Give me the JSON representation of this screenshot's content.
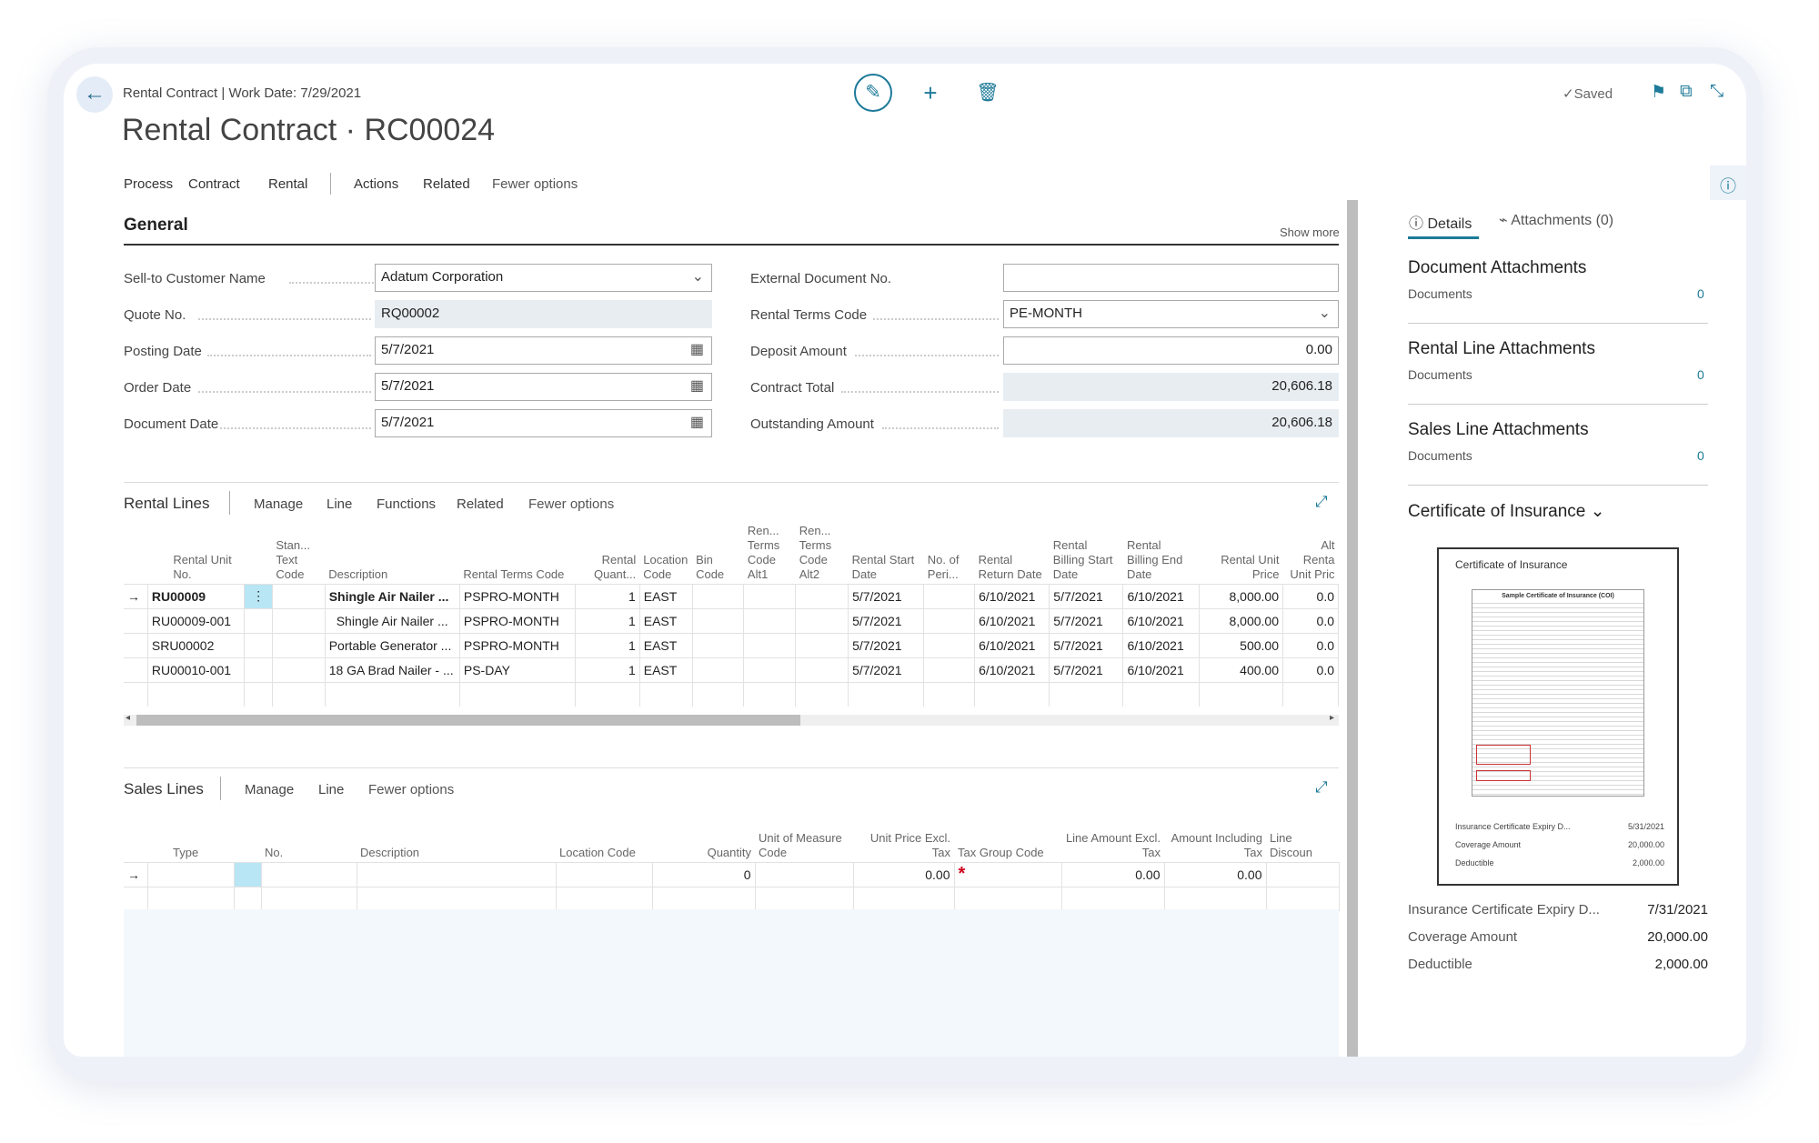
{
  "header": {
    "breadcrumb": "Rental Contract | Work Date: 7/29/2021",
    "title": "Rental Contract · RC00024",
    "saved": "Saved"
  },
  "menu": [
    "Process",
    "Contract",
    "Rental",
    "Actions",
    "Related",
    "Fewer options"
  ],
  "general": {
    "title": "General",
    "show_more": "Show more",
    "left": [
      {
        "label": "Sell-to Customer Name",
        "value": "Adatum Corporation"
      },
      {
        "label": "Quote No.",
        "value": "RQ00002"
      },
      {
        "label": "Posting Date",
        "value": "5/7/2021"
      },
      {
        "label": "Order Date",
        "value": "5/7/2021"
      },
      {
        "label": "Document Date",
        "value": "5/7/2021"
      }
    ],
    "right": [
      {
        "label": "External Document No.",
        "value": ""
      },
      {
        "label": "Rental Terms Code",
        "value": "PE-MONTH"
      },
      {
        "label": "Deposit Amount",
        "value": "0.00"
      },
      {
        "label": "Contract Total",
        "value": "20,606.18"
      },
      {
        "label": "Outstanding Amount",
        "value": "20,606.18"
      }
    ]
  },
  "rental_lines": {
    "title": "Rental Lines",
    "menu": [
      "Manage",
      "Line",
      "Functions",
      "Related",
      "Fewer options"
    ],
    "columns": [
      "Rental Unit No.",
      "Stan... Text Code",
      "Description",
      "Rental Terms Code",
      "Rental Quant...",
      "Location Code",
      "Bin Code",
      "Ren... Terms Code Alt1",
      "Ren... Terms Code Alt2",
      "Rental Start Date",
      "No. of Peri...",
      "Rental Return Date",
      "Rental Billing Start Date",
      "Rental Billing End Date",
      "Rental Unit Price",
      "Alt Renta Unit Pric"
    ],
    "rows": [
      [
        "RU00009",
        "",
        "Shingle Air Nailer ...",
        "PSPRO-MONTH",
        "1",
        "EAST",
        "",
        "",
        "",
        "5/7/2021",
        "",
        "6/10/2021",
        "5/7/2021",
        "6/10/2021",
        "8,000.00",
        "0.0"
      ],
      [
        "RU00009-001",
        "",
        "Shingle Air Nailer ...",
        "PSPRO-MONTH",
        "1",
        "EAST",
        "",
        "",
        "",
        "5/7/2021",
        "",
        "6/10/2021",
        "5/7/2021",
        "6/10/2021",
        "8,000.00",
        "0.0"
      ],
      [
        "SRU00002",
        "",
        "Portable Generator ...",
        "PSPRO-MONTH",
        "1",
        "EAST",
        "",
        "",
        "",
        "5/7/2021",
        "",
        "6/10/2021",
        "5/7/2021",
        "6/10/2021",
        "500.00",
        "0.0"
      ],
      [
        "RU00010-001",
        "",
        "18 GA Brad Nailer - ...",
        "PS-DAY",
        "1",
        "EAST",
        "",
        "",
        "",
        "5/7/2021",
        "",
        "6/10/2021",
        "5/7/2021",
        "6/10/2021",
        "400.00",
        "0.0"
      ]
    ]
  },
  "sales_lines": {
    "title": "Sales Lines",
    "menu": [
      "Manage",
      "Line",
      "Fewer options"
    ],
    "columns": [
      "Type",
      "No.",
      "Description",
      "Location Code",
      "Quantity",
      "Unit of Measure Code",
      "Unit Price Excl. Tax",
      "Tax Group Code",
      "Line Amount Excl. Tax",
      "Amount Including Tax",
      "Line Discoun"
    ],
    "row": [
      "",
      "",
      "",
      "",
      "0",
      "",
      "0.00",
      "*",
      "0.00",
      "0.00",
      ""
    ]
  },
  "factbox": {
    "tabs": [
      "Details",
      "Attachments (0)"
    ],
    "sections": [
      {
        "title": "Document Attachments",
        "label": "Documents",
        "value": "0"
      },
      {
        "title": "Rental Line Attachments",
        "label": "Documents",
        "value": "0"
      },
      {
        "title": "Sales Line Attachments",
        "label": "Documents",
        "value": "0"
      }
    ],
    "certificate": {
      "title": "Certificate of Insurance",
      "thumb_title": "Certificate of Insurance",
      "doc_title": "Sample Certificate of Insurance (COI)",
      "thumb_rows": [
        {
          "label": "Insurance Certificate Expiry D...",
          "value": "5/31/2021"
        },
        {
          "label": "Coverage Amount",
          "value": "20,000.00"
        },
        {
          "label": "Deductible",
          "value": "2,000.00"
        }
      ],
      "rows": [
        {
          "label": "Insurance Certificate Expiry D...",
          "value": "7/31/2021"
        },
        {
          "label": "Coverage Amount",
          "value": "20,000.00"
        },
        {
          "label": "Deductible",
          "value": "2,000.00"
        }
      ]
    }
  }
}
